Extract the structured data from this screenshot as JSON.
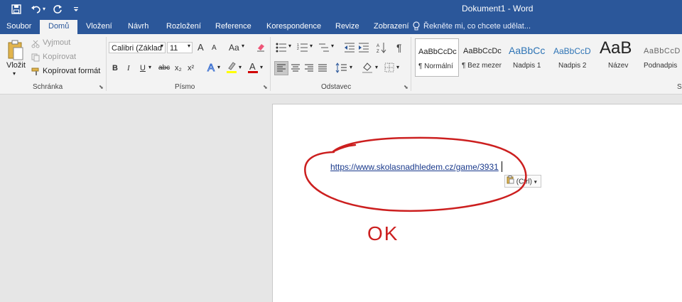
{
  "titlebar": {
    "doc_title": "Dokument1 - Word",
    "icons": [
      "save-icon",
      "undo-icon",
      "redo-icon",
      "customize-qat-icon"
    ]
  },
  "tabs": [
    {
      "label": "Soubor",
      "active": false
    },
    {
      "label": "Domů",
      "active": true
    },
    {
      "label": "Vložení",
      "active": false
    },
    {
      "label": "Návrh",
      "active": false
    },
    {
      "label": "Rozložení",
      "active": false
    },
    {
      "label": "Reference",
      "active": false
    },
    {
      "label": "Korespondence",
      "active": false
    },
    {
      "label": "Revize",
      "active": false
    },
    {
      "label": "Zobrazení",
      "active": false
    }
  ],
  "tell_me": "Řekněte mi, co chcete udělat...",
  "clipboard": {
    "paste": "Vložit",
    "cut": "Vyjmout",
    "copy": "Kopírovat",
    "format_painter": "Kopírovat formát",
    "group_label": "Schránka"
  },
  "font": {
    "font_name": "Calibri (Základ",
    "font_size": "11",
    "group_label": "Písmo",
    "bold": "B",
    "italic": "I",
    "underline": "U",
    "strike": "abc",
    "subscript": "x₂",
    "superscript": "x²",
    "grow": "A",
    "shrink": "A",
    "case": "Aa"
  },
  "paragraph": {
    "group_label": "Odstavec"
  },
  "styles": {
    "items": [
      {
        "sample": "AaBbCcDc",
        "label": "¶ Normální"
      },
      {
        "sample": "AaBbCcDc",
        "label": "¶ Bez mezer"
      },
      {
        "sample": "AaBbCc",
        "label": "Nadpis 1"
      },
      {
        "sample": "AaBbCcD",
        "label": "Nadpis 2"
      },
      {
        "sample": "AaB",
        "label": "Název"
      },
      {
        "sample": "AaBbCcD",
        "label": "Podnadpis"
      }
    ],
    "group_label_partial": "S"
  },
  "document": {
    "link": "https://www.skolasnadhledem.cz/game/3931",
    "paste_options": "(Ctrl)",
    "annotation": "OK",
    "accent": "#2b579a",
    "ink": "#cc1f1f"
  }
}
